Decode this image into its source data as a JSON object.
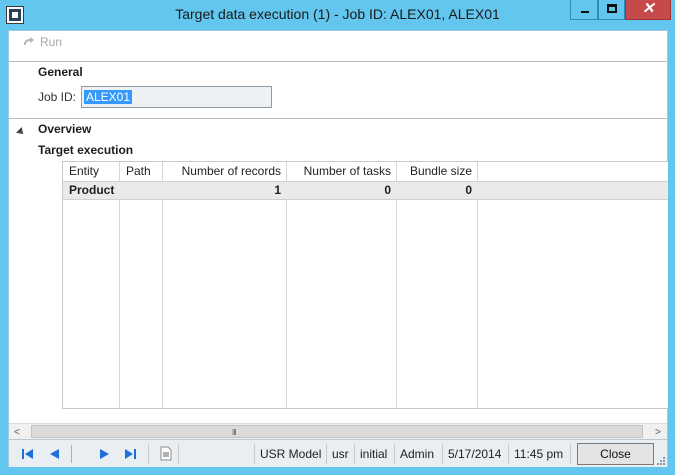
{
  "window": {
    "title": "Target data execution (1) - Job ID: ALEX01, ALEX01",
    "close_glyph": "✕"
  },
  "toolbar": {
    "run_label": "Run"
  },
  "general": {
    "heading": "General",
    "job_id_label": "Job ID:",
    "job_id_value": "ALEX01"
  },
  "overview": {
    "heading": "Overview",
    "subheading": "Target execution"
  },
  "grid": {
    "columns": [
      "Entity",
      "Path",
      "Number of records",
      "Number of tasks",
      "Bundle size"
    ],
    "rows": [
      {
        "entity": "Product",
        "path": "",
        "records": "1",
        "tasks": "0",
        "bundle": "0"
      }
    ]
  },
  "scrollbar": {
    "left_arrow": "<",
    "right_arrow": ">",
    "grip": "III"
  },
  "status": {
    "model": "USR Model",
    "layer": "usr",
    "partition": "initial",
    "user": "Admin",
    "date": "5/17/2014",
    "time": "11:45 pm",
    "close_label": "Close"
  },
  "colors": {
    "titlebar": "#63c6ee",
    "selection": "#3399ff",
    "nav_arrows": "#1e6fd9",
    "close_window": "#c74a4a"
  }
}
